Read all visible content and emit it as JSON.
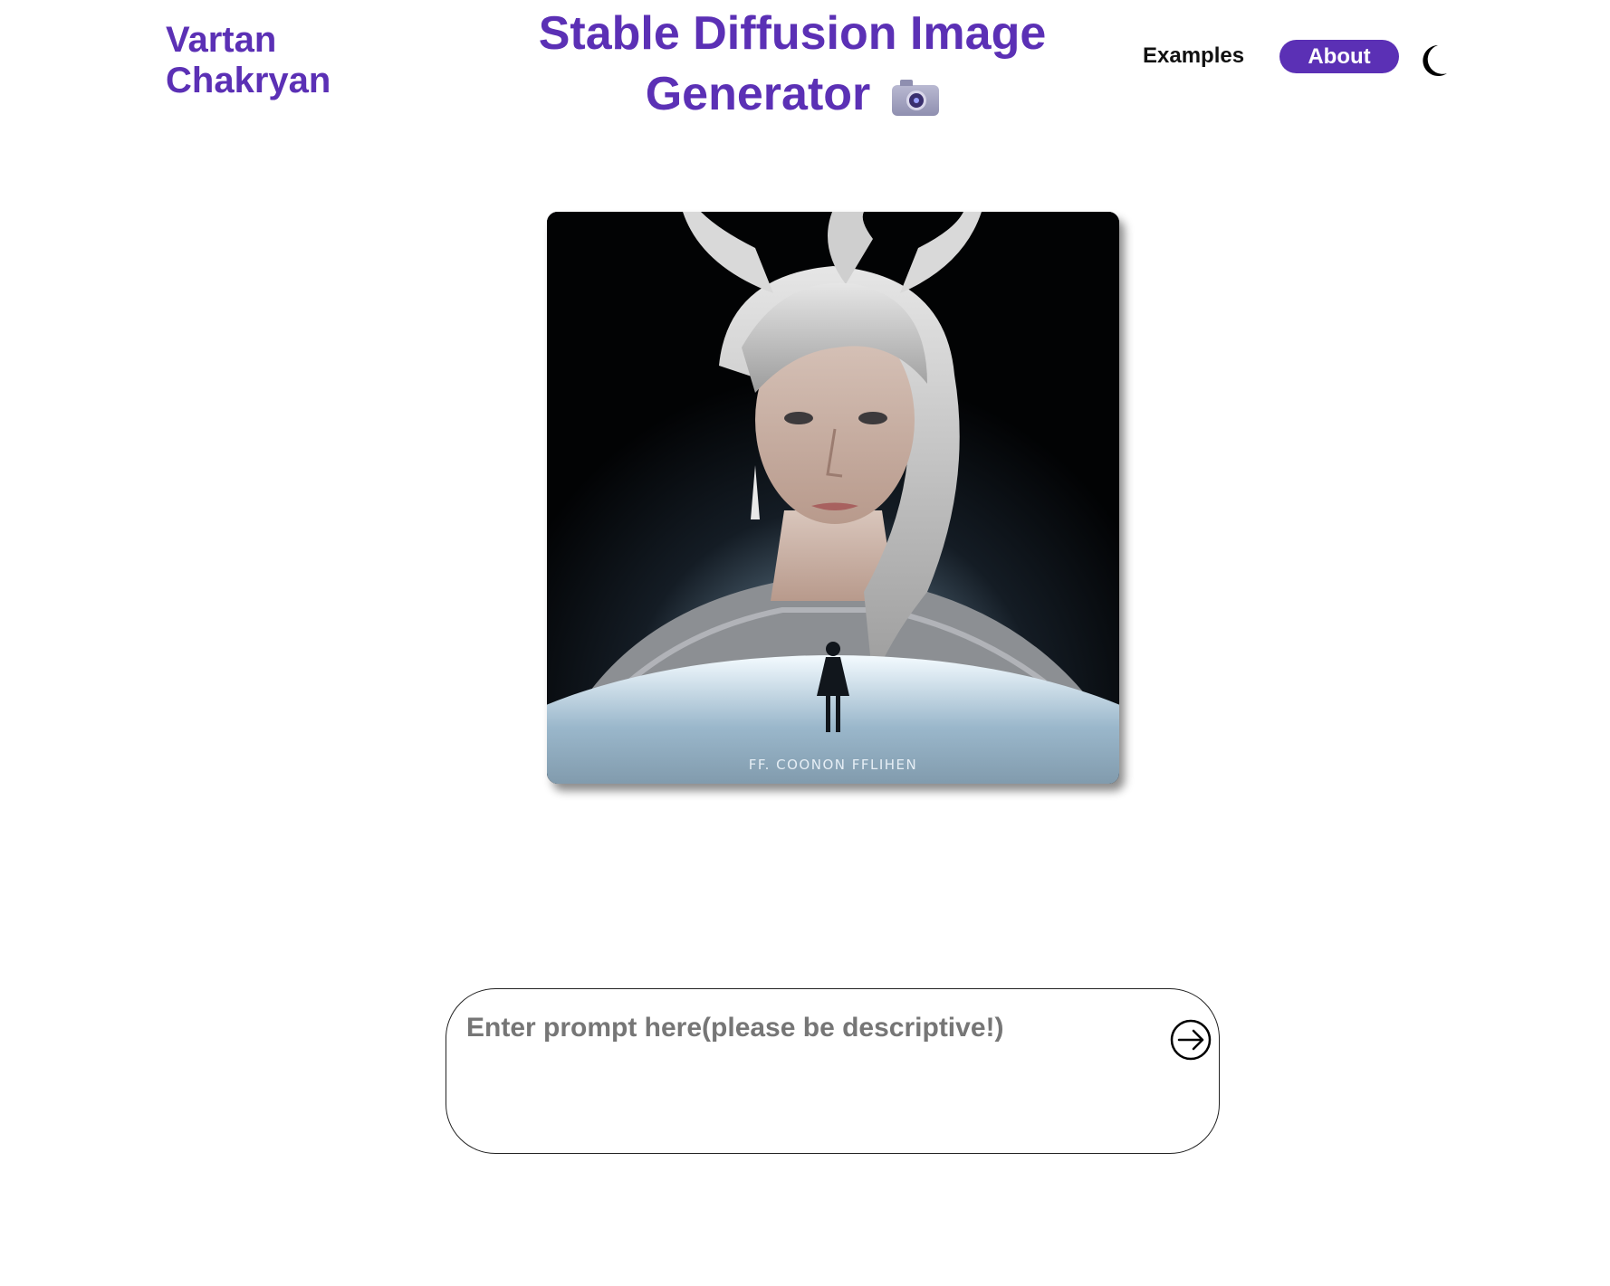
{
  "brand": {
    "line1": "Vartan",
    "line2": "Chakryan"
  },
  "header": {
    "title_line1": "Stable Diffusion Image",
    "title_line2": "Generator",
    "title_icon": "camera-icon"
  },
  "nav": {
    "examples_label": "Examples",
    "about_label": "About",
    "theme_toggle_icon": "moon-icon"
  },
  "generated_image": {
    "caption_text": "FF. COONON FFLIHEN"
  },
  "prompt": {
    "value": "",
    "placeholder": "Enter prompt here(please be descriptive!)",
    "submit_icon": "arrow-right-circle-icon"
  },
  "colors": {
    "accent": "#5b30b5",
    "background": "#ffffff",
    "text": "#111111"
  }
}
